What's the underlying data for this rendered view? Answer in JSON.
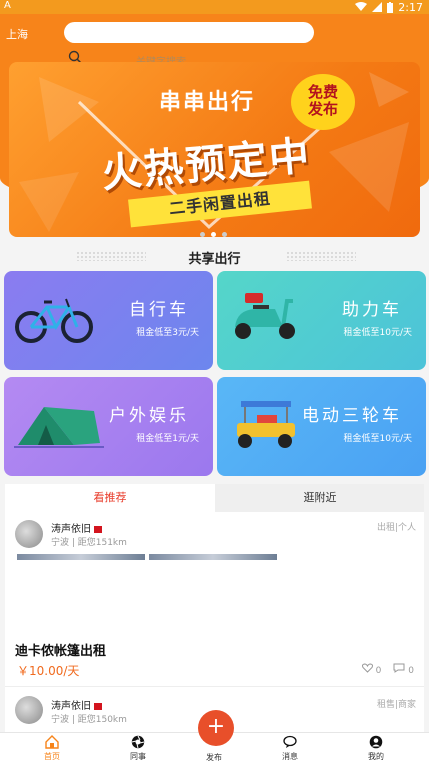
{
  "status_bar": {
    "left_icon": "A",
    "time": "2:17"
  },
  "header": {
    "city": "上海",
    "search_placeholder": "关键字搜索"
  },
  "banner": {
    "brand": "串串出行",
    "badge_line1": "免费",
    "badge_line2": "发布",
    "headline": "火热预定中",
    "strip": "二手闲置出租",
    "dot_count": 3,
    "active_dot": 1
  },
  "section": {
    "title": "共享出行"
  },
  "categories": [
    {
      "title": "自行车",
      "sub": "租金低至3元/天",
      "icon": "bicycle-icon"
    },
    {
      "title": "助力车",
      "sub": "租金低至10元/天",
      "icon": "scooter-icon"
    },
    {
      "title": "户外娱乐",
      "sub": "租金低至1元/天",
      "icon": "tent-icon"
    },
    {
      "title": "电动三轮车",
      "sub": "租金低至10元/天",
      "icon": "tricycle-icon"
    }
  ],
  "tabs": [
    {
      "label": "看推荐"
    },
    {
      "label": "逛附近"
    }
  ],
  "posts": [
    {
      "user": "涛声依旧",
      "info": "宁波 | 距您151km",
      "tag": "出租|个人",
      "title": "迪卡侬帐篷出租",
      "price": "￥10.00/天",
      "likes": "0",
      "comments": "0"
    },
    {
      "user": "涛声依旧",
      "info": "宁波 | 距您150km",
      "tag": "租售|商家"
    }
  ],
  "bottom_nav": [
    {
      "label": "首页",
      "icon": "home-icon"
    },
    {
      "label": "同事",
      "icon": "aperture-icon"
    },
    {
      "label": "发布",
      "icon": "plus-icon"
    },
    {
      "label": "消息",
      "icon": "chat-icon"
    },
    {
      "label": "我的",
      "icon": "user-icon"
    }
  ],
  "colors": {
    "primary": "#f7841a",
    "accent_red": "#e83b2a",
    "price": "#f06a1e"
  }
}
